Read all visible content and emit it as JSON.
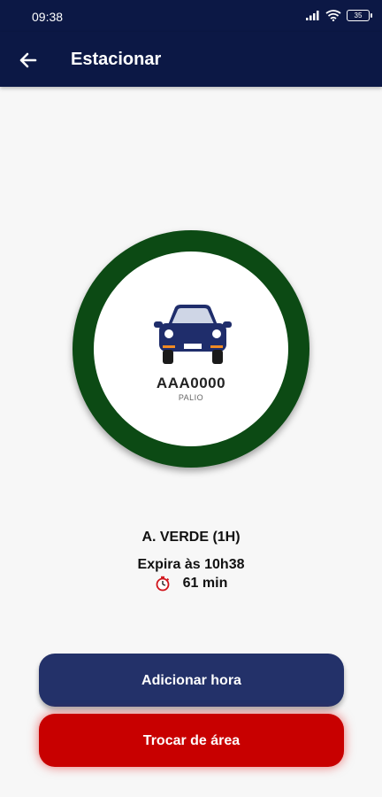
{
  "status_bar": {
    "time": "09:38",
    "battery": "35"
  },
  "header": {
    "title": "Estacionar"
  },
  "vehicle": {
    "plate": "AAA0000",
    "model": "PALIO"
  },
  "parking": {
    "area": "A. VERDE (1H)",
    "expires": "Expira às 10h38",
    "remaining": "61 min"
  },
  "actions": {
    "add_hour": "Adicionar hora",
    "change_area": "Trocar de área"
  },
  "colors": {
    "header": "#0c1845",
    "ring": "#0c4a14",
    "primary_button": "#233169",
    "danger_button": "#c80000"
  },
  "icons": [
    "back-arrow-icon",
    "car-icon",
    "timer-icon",
    "signal-icon",
    "wifi-icon",
    "battery-icon"
  ]
}
